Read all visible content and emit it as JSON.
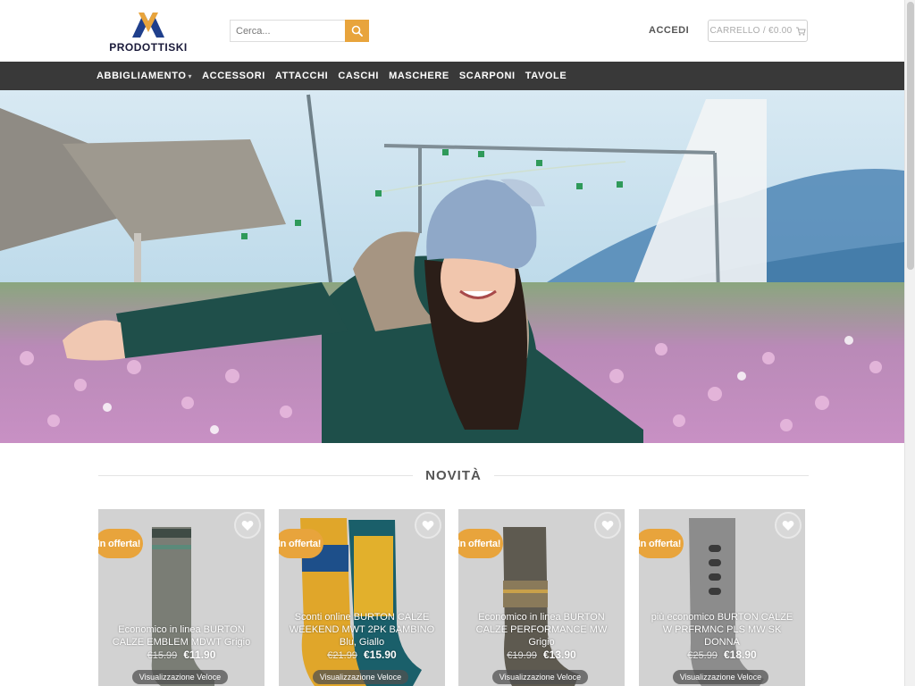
{
  "brand": {
    "name": "PRODOTTISKI"
  },
  "search": {
    "placeholder": "Cerca..."
  },
  "account": {
    "login_label": "ACCEDI"
  },
  "cart": {
    "label": "CARRELLO / €0.00"
  },
  "nav": {
    "items": [
      {
        "label": "ABBIGLIAMENTO",
        "has_dropdown": true
      },
      {
        "label": "ACCESSORI"
      },
      {
        "label": "ATTACCHI"
      },
      {
        "label": "CASCHI"
      },
      {
        "label": "MASCHERE"
      },
      {
        "label": "SCARPONI"
      },
      {
        "label": "TAVOLE"
      }
    ]
  },
  "section": {
    "title": "NOVITÀ"
  },
  "products": [
    {
      "badge": "In offerta!",
      "title": "Economico in linea BURTON CALZE EMBLEM MDWT Grigio",
      "old_price": "€15.99",
      "price": "€11.90",
      "quick_view": "Visualizzazione Veloce"
    },
    {
      "badge": "In offerta!",
      "title": "Sconti online BURTON CALZE WEEKEND MWT 2PK BAMBINO Blu, Giallo",
      "old_price": "€21.99",
      "price": "€15.90",
      "quick_view": "Visualizzazione Veloce"
    },
    {
      "badge": "In offerta!",
      "title": "Economico in linea BURTON CALZE PERFORMANCE MW Grigio",
      "old_price": "€19.99",
      "price": "€13.90",
      "quick_view": "Visualizzazione Veloce"
    },
    {
      "badge": "In offerta!",
      "title": "più economico BURTON CALZE W PRFRMNC PLS MW SK DONNA",
      "old_price": "€25.99",
      "price": "€18.90",
      "quick_view": "Visualizzazione Veloce"
    }
  ],
  "colors": {
    "accent": "#e8a43c",
    "nav_bg": "#393939"
  },
  "icons": {
    "search": "search-icon",
    "cart": "cart-icon",
    "wishlist": "heart-icon"
  }
}
